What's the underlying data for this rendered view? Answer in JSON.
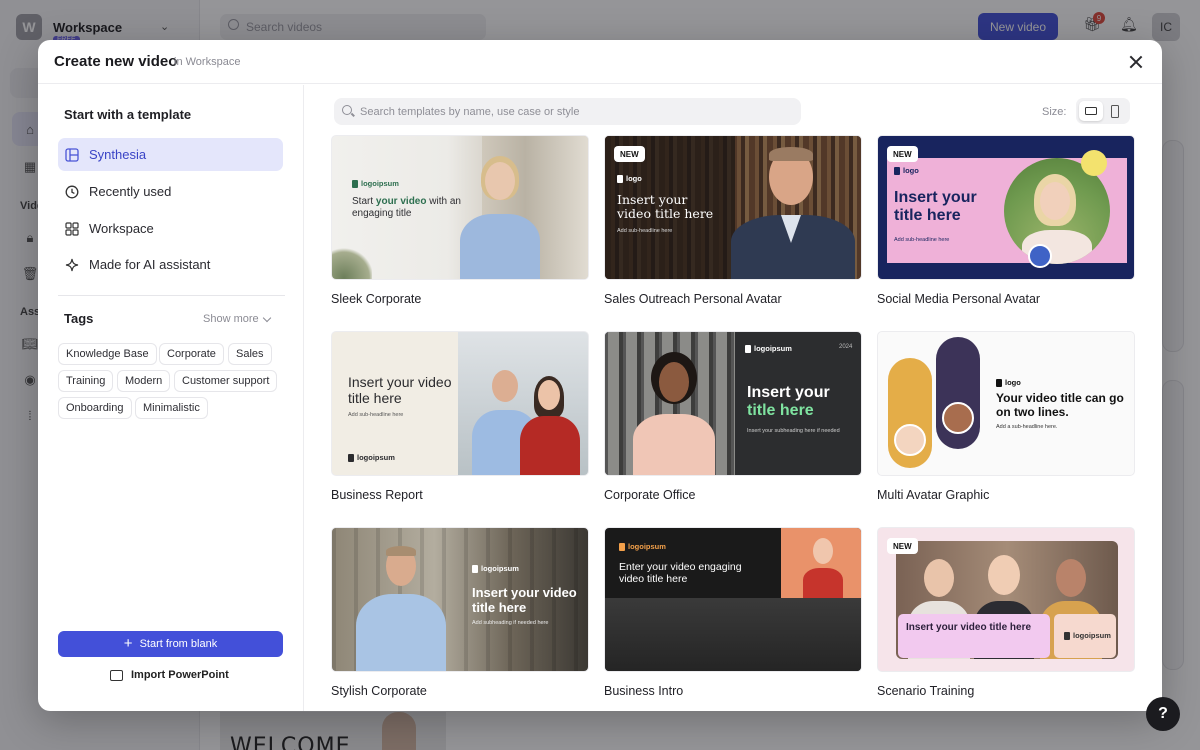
{
  "app": {
    "workspace_initial": "W",
    "workspace_name": "Workspace",
    "workspace_plan": "FREE",
    "search_placeholder": "Search videos",
    "new_video_label": "New video",
    "gift_badge_count": "9",
    "user_initials": "IC",
    "sidebar_labels": [
      "Vide",
      "Ass"
    ],
    "welcome_text": "WELCOME",
    "help_label": "?"
  },
  "modal": {
    "title": "Create new video",
    "subtitle": "in Workspace",
    "left": {
      "heading": "Start with a template",
      "nav": [
        {
          "label": "Synthesia",
          "icon": "layout-icon",
          "active": true
        },
        {
          "label": "Recently used",
          "icon": "clock-icon",
          "active": false
        },
        {
          "label": "Workspace",
          "icon": "grid-icon",
          "active": false
        },
        {
          "label": "Made for AI assistant",
          "icon": "sparkle-icon",
          "active": false
        }
      ],
      "tags_title": "Tags",
      "show_more": "Show more",
      "tags": [
        "Knowledge Base",
        "Corporate",
        "Sales",
        "Training",
        "Modern",
        "Customer support",
        "Onboarding",
        "Minimalistic"
      ],
      "start_blank": "Start from blank",
      "import_ppt": "Import PowerPoint"
    },
    "search_placeholder": "Search templates by name, use case or style",
    "size_label": "Size:",
    "templates": [
      {
        "name": "Sleek Corporate",
        "badge": "",
        "logo": "logoipsum",
        "title": "Start your video with an engaging title",
        "highlight": "your video",
        "sub": ""
      },
      {
        "name": "Sales Outreach Personal Avatar",
        "badge": "NEW",
        "logo": "logo",
        "title": "Insert your video title here",
        "sub": "Add sub-headline here"
      },
      {
        "name": "Social Media Personal Avatar",
        "badge": "NEW",
        "logo": "logo",
        "title": "Insert your title here",
        "sub": "Add sub-headline here"
      },
      {
        "name": "Business Report",
        "badge": "",
        "logo": "logoipsum",
        "title": "Insert your video title here",
        "sub": "Add sub-headline here"
      },
      {
        "name": "Corporate Office",
        "badge": "",
        "logo": "logoipsum",
        "title": "Insert your title here",
        "sub": "Insert your subheading here if needed",
        "corner": "2024"
      },
      {
        "name": "Multi Avatar Graphic",
        "badge": "",
        "logo": "logo",
        "title": "Your video title can go on two lines.",
        "sub": "Add a sub-headline here."
      },
      {
        "name": "Stylish Corporate",
        "badge": "",
        "logo": "logoipsum",
        "title": "Insert your video title here",
        "sub": "Add subheading if needed here"
      },
      {
        "name": "Business Intro",
        "badge": "",
        "logo": "logoipsum",
        "title": "Enter your video engaging video title here",
        "sub": ""
      },
      {
        "name": "Scenario Training",
        "badge": "NEW",
        "logo": "logoipsum",
        "title": "Insert your video title here",
        "sub": ""
      }
    ]
  },
  "colors": {
    "accent": "#4350d9",
    "active_nav_bg": "#e4e6fb",
    "overlay": "rgba(20,20,26,0.45)",
    "social_navy": "#18245e",
    "social_pink": "#efb1d8"
  }
}
